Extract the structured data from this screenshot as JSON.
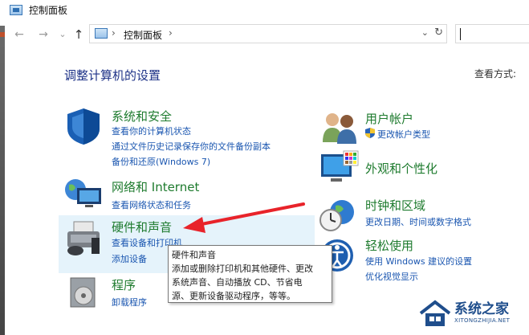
{
  "window": {
    "title": "控制面板"
  },
  "address": {
    "path": "控制面板",
    "sep1": "›",
    "sep2": "›"
  },
  "nav": {
    "back": "←",
    "forward": "→",
    "down": "⌄",
    "up": "↑",
    "dropdown": "⌄",
    "refresh": "↻"
  },
  "main": {
    "heading": "调整计算机的设置",
    "view_by": "查看方式:"
  },
  "left_categories": [
    {
      "title": "系统和安全",
      "links": [
        "查看你的计算机状态",
        "通过文件历史记录保存你的文件备份副本",
        "备份和还原(Windows 7)"
      ]
    },
    {
      "title": "网络和 Internet",
      "links": [
        "查看网络状态和任务"
      ]
    },
    {
      "title": "硬件和声音",
      "links": [
        "查看设备和打印机",
        "添加设备"
      ]
    },
    {
      "title": "程序",
      "links": [
        "卸载程序"
      ]
    }
  ],
  "right_categories": [
    {
      "title": "用户帐户",
      "links": [
        "更改帐户类型"
      ]
    },
    {
      "title": "外观和个性化",
      "links": []
    },
    {
      "title": "时钟和区域",
      "links": [
        "更改日期、时间或数字格式"
      ]
    },
    {
      "title": "轻松使用",
      "links": [
        "使用 Windows 建议的设置",
        "优化视觉显示"
      ]
    }
  ],
  "tooltip": {
    "title": "硬件和声音",
    "lines": [
      "添加或删除打印机和其他硬件、更改",
      "系统声音、自动播放 CD、节省电",
      "源、更新设备驱动程序，等等。"
    ]
  },
  "watermark": {
    "text": "系统之家",
    "sub": "XITONGZHIJIA.NET"
  },
  "colors": {
    "category_title": "#1e7b2e",
    "link": "#1a56b0",
    "heading": "#1e3287",
    "arrow": "#e8232a",
    "highlight": "#e5f3fb"
  }
}
